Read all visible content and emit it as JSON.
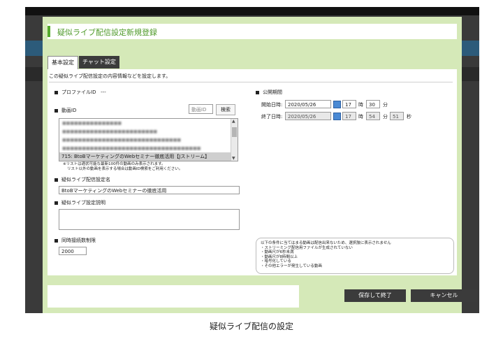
{
  "dialog": {
    "title": "疑似ライブ配信設定新規登録",
    "tabs": [
      {
        "label": "基本設定"
      },
      {
        "label": "チャット設定"
      }
    ],
    "description": "この疑似ライブ配信設定の内容情報などを設定します。",
    "profile_id": {
      "label": "プロファイルID",
      "value": "---"
    },
    "video_id": {
      "label": "動画ID",
      "search_placeholder": "動画ID",
      "search_button": "検索",
      "selected_item": "715: BtoBマーケティングのWebセミナー徹底活用【Jストリーム】",
      "note_line1": "※リストは適状可能な最新100件の動画のみ表示されます。",
      "note_line2": "リスト以外の動画を表示する場合は動画ID検索をご利用ください。"
    },
    "setting_name": {
      "label": "疑似ライブ配信設定名",
      "value": "BtoBマーケティングのWebセミナーの徹底活用"
    },
    "setting_desc": {
      "label": "疑似ライブ設定説明",
      "value": ""
    },
    "concurrent_limit": {
      "label": "同時接続数制限",
      "value": "2000"
    },
    "publish_period": {
      "label": "公開期間",
      "start_label": "開始日時:",
      "start_date": "2020/05/26",
      "start_hour": "17",
      "start_min": "30",
      "end_label": "終了日時:",
      "end_date": "2020/05/26",
      "end_hour": "17",
      "end_min": "54",
      "end_sec": "51",
      "unit_hour": "時",
      "unit_min": "分",
      "unit_sec": "秒"
    },
    "conditions": {
      "header": "以下の条件に当てはまる動画は配信出来ないため、選択肢に表示されません",
      "items": [
        "・ストリーミング配信用ファイルが生成されていない",
        "・動画尺が6秒未満",
        "・動画尺が8時間以上",
        "・暗号化している",
        "・その他エラーが発生している動画"
      ]
    },
    "buttons": {
      "save": "保存して終了",
      "cancel": "キャンセル"
    }
  },
  "caption": "疑似ライブ配信の設定",
  "colors": {
    "accent": "#55aa2c",
    "dialog_bg": "#d5e9b8",
    "dark_button": "#3b3b3b"
  }
}
